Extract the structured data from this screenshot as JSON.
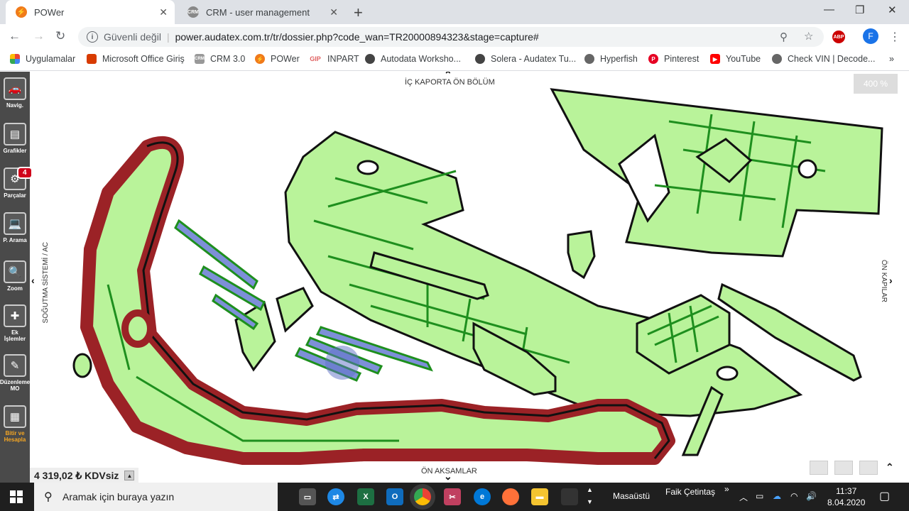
{
  "browser": {
    "tabs": [
      {
        "title": "POWer",
        "active": true
      },
      {
        "title": "CRM - user management",
        "active": false
      }
    ],
    "address": {
      "security_label": "Güvenli değil",
      "url": "power.audatex.com.tr/tr/dossier.php?code_wan=TR20000894323&stage=capture#"
    },
    "profile_initial": "F",
    "abp_label": "ABP",
    "bookmarks": [
      {
        "label": "Uygulamalar"
      },
      {
        "label": "Microsoft Office Giriş"
      },
      {
        "label": "CRM 3.0"
      },
      {
        "label": "POWer"
      },
      {
        "label": "INPART"
      },
      {
        "label": "Autodata Worksho..."
      },
      {
        "label": "Solera - Audatex Tu..."
      },
      {
        "label": "Hyperfish"
      },
      {
        "label": "Pinterest"
      },
      {
        "label": "YouTube"
      },
      {
        "label": "Check VIN | Decode..."
      }
    ]
  },
  "sidebar": {
    "items": [
      {
        "label": "Navig.",
        "icon": "car-icon"
      },
      {
        "label": "Grafikler",
        "icon": "document-icon"
      },
      {
        "label": "Parçalar",
        "icon": "gear-icon"
      },
      {
        "label": "P. Arama",
        "icon": "laptop-icon"
      },
      {
        "label": "Zoom",
        "icon": "magnifier-icon"
      },
      {
        "label": "Ek İşlemler",
        "icon": "plus-icon"
      },
      {
        "label": "Düzenleme MO",
        "icon": "pencil-icon"
      },
      {
        "label": "Bitir ve Hesapla",
        "icon": "grid-icon"
      }
    ],
    "parts_badge": "4"
  },
  "diagram": {
    "nav_top": "İÇ KAPORTA ÖN BÖLÜM",
    "nav_bottom": "ÖN AKSAMLAR",
    "nav_left": "SOĞUTMA SİSTEMİ / AC",
    "nav_right": "ÖN KAPILAR",
    "zoom_level": "400 %",
    "colors": {
      "part_fill": "#b9f39a",
      "part_line": "#1e8f1e",
      "outline": "#111111",
      "selected": "#9b2226",
      "hover": "#7d8fd8"
    }
  },
  "footer": {
    "price": "4 319,02 ₺ KDVsiz"
  },
  "taskbar": {
    "search_placeholder": "Aramak için buraya yazın",
    "desktop_label": "Masaüstü",
    "user_label": "Faik Çetintaş",
    "time": "11:37",
    "date": "8.04.2020"
  }
}
